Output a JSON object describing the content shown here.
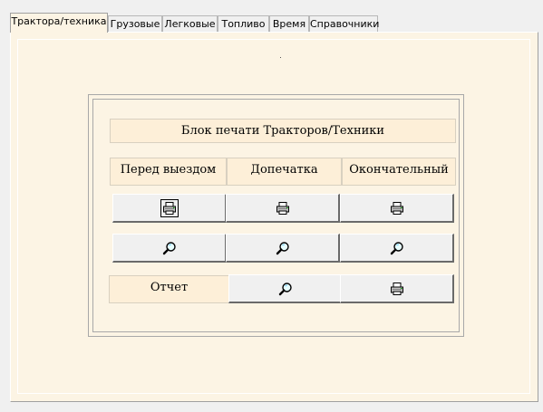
{
  "tabs": [
    {
      "label": "Трактора/техника",
      "active": true
    },
    {
      "label": "Грузовые",
      "active": false
    },
    {
      "label": "Легковые",
      "active": false
    },
    {
      "label": "Топливо",
      "active": false
    },
    {
      "label": "Время",
      "active": false
    },
    {
      "label": "Справочники",
      "active": false
    }
  ],
  "print_block": {
    "title": "Блок печати Тракторов/Техники",
    "columns": [
      "Перед выездом",
      "Допечатка",
      "Окончательный"
    ],
    "print_row": [
      "printer-icon",
      "printer-icon",
      "printer-icon"
    ],
    "preview_row": [
      "magnifier-icon",
      "magnifier-icon",
      "magnifier-icon"
    ],
    "report": {
      "label": "Отчет",
      "buttons": [
        "magnifier-icon",
        "printer-icon"
      ]
    }
  },
  "colors": {
    "panel_bg": "#fcf4e4",
    "label_bg": "#fdefd8",
    "button_bg": "#f0f0f0"
  }
}
